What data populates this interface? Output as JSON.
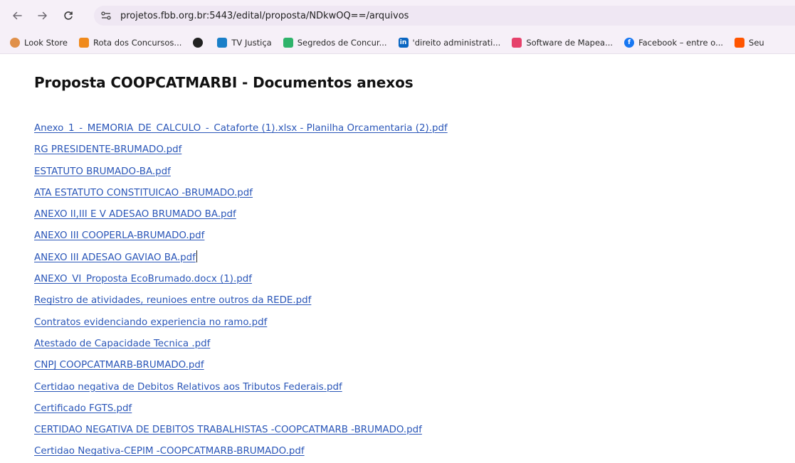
{
  "browser": {
    "url": "projetos.fbb.org.br:5443/edital/proposta/NDkwOQ==/arquivos"
  },
  "bookmarks": [
    {
      "label": "Look Store",
      "icon": "gear-icon",
      "color": "#e0904a"
    },
    {
      "label": "Rota dos Concursos...",
      "icon": "orange-square-icon",
      "color": "#f08a1c"
    },
    {
      "label": "",
      "icon": "github-icon",
      "color": "#222222"
    },
    {
      "label": "TV Justiça",
      "icon": "tv-justica-icon",
      "color": "#1a7fc8"
    },
    {
      "label": "Segredos de Concur...",
      "icon": "bookmark-icon",
      "color": "#2fb36b"
    },
    {
      "label": "'direito administrati...",
      "icon": "linkedin-icon",
      "color": "#0a66c2"
    },
    {
      "label": "Software de Mapea...",
      "icon": "mapping-icon",
      "color": "#e6416b"
    },
    {
      "label": "Facebook – entre o...",
      "icon": "facebook-icon",
      "color": "#1877f2"
    },
    {
      "label": "Seu",
      "icon": "soundcloud-icon",
      "color": "#ff5500"
    }
  ],
  "page": {
    "title": "Proposta COOPCATMARBI - Documentos anexos",
    "files": [
      "Anexo_1_-_MEMORIA_DE_CALCULO_-_Cataforte (1).xlsx - Planilha Orcamentaria (2).pdf",
      "RG PRESIDENTE-BRUMADO.pdf",
      "ESTATUTO BRUMADO-BA.pdf",
      "ATA ESTATUTO CONSTITUICAO -BRUMADO.pdf",
      "ANEXO II,III E V ADESAO BRUMADO BA.pdf",
      "ANEXO III COOPERLA-BRUMADO.pdf",
      "ANEXO III ADESAO GAVIAO BA.pdf",
      "ANEXO_VI_Proposta EcoBrumado.docx (1).pdf",
      "Registro de atividades, reunioes entre outros da REDE.pdf",
      "Contratos evidenciando experiencia no ramo.pdf",
      "Atestado de Capacidade Tecnica .pdf",
      "CNPJ COOPCATMARB-BRUMADO.pdf",
      "Certidao negativa de Debitos Relativos aos Tributos Federais.pdf",
      "Certificado FGTS.pdf",
      "CERTIDAO NEGATIVA DE DEBITOS TRABALHISTAS -COOPCATMARB -BRUMADO.pdf",
      "Certidao Negativa-CEPIM -COOPCATMARB-BRUMADO.pdf"
    ]
  }
}
